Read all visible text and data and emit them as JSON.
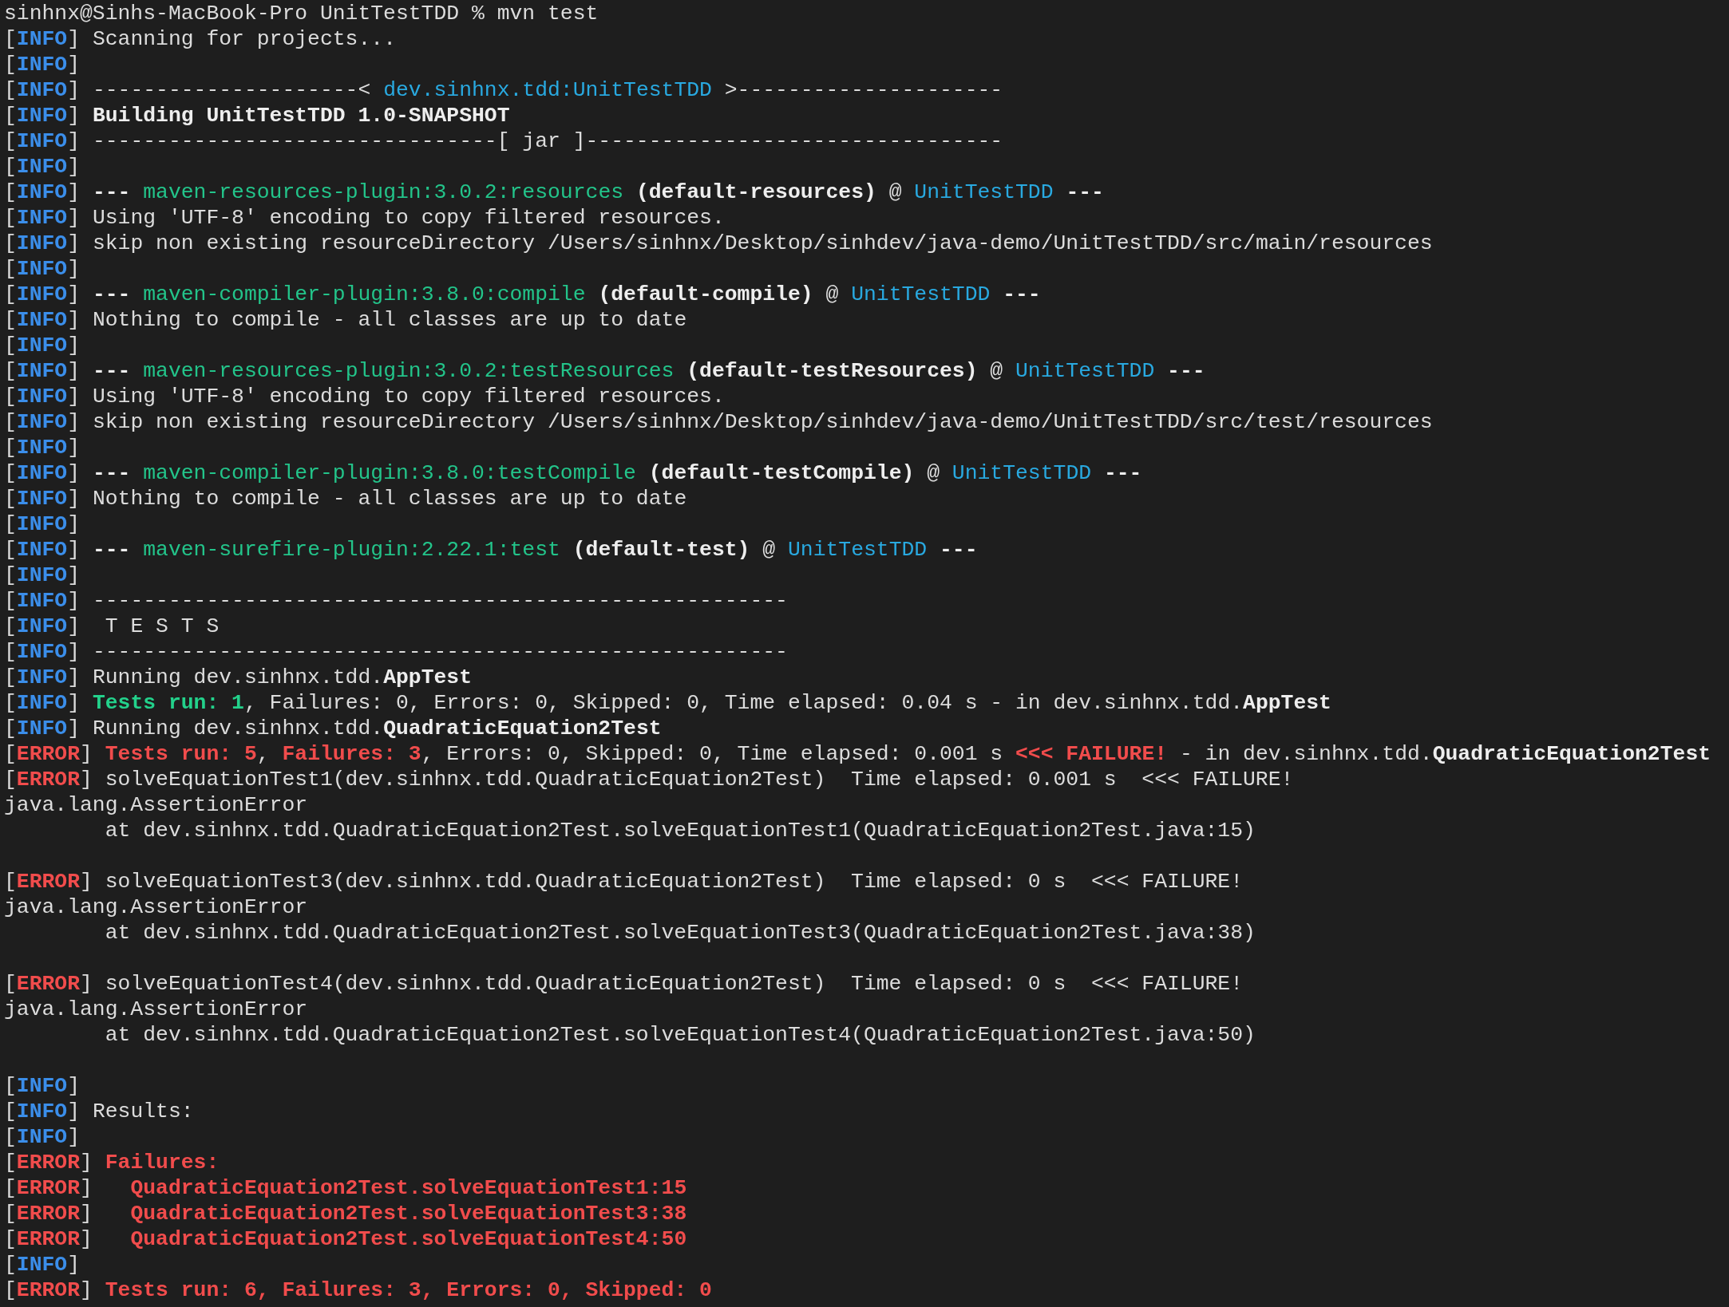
{
  "terminal": {
    "lines": [
      {
        "kind": "text",
        "parts": [
          {
            "kind": "plain",
            "text": "sinhnx@Sinhs-MacBook-Pro UnitTestTDD % mvn test"
          }
        ]
      },
      {
        "kind": "text",
        "parts": [
          {
            "kind": "plain",
            "text": "["
          },
          {
            "kind": "info",
            "text": "INFO"
          },
          {
            "kind": "plain",
            "text": "] Scanning for projects..."
          }
        ]
      },
      {
        "kind": "text",
        "parts": [
          {
            "kind": "plain",
            "text": "["
          },
          {
            "kind": "info",
            "text": "INFO"
          },
          {
            "kind": "plain",
            "text": "]"
          }
        ]
      },
      {
        "kind": "text",
        "parts": [
          {
            "kind": "plain",
            "text": "["
          },
          {
            "kind": "info",
            "text": "INFO"
          },
          {
            "kind": "plain",
            "text": "] ---------------------< "
          },
          {
            "kind": "project",
            "text": "dev.sinhnx.tdd:UnitTestTDD"
          },
          {
            "kind": "plain",
            "text": " >---------------------"
          }
        ]
      },
      {
        "kind": "text",
        "parts": [
          {
            "kind": "plain",
            "text": "["
          },
          {
            "kind": "info",
            "text": "INFO"
          },
          {
            "kind": "plain",
            "text": "] "
          },
          {
            "kind": "bold",
            "text": "Building UnitTestTDD 1.0-SNAPSHOT"
          }
        ]
      },
      {
        "kind": "text",
        "parts": [
          {
            "kind": "plain",
            "text": "["
          },
          {
            "kind": "info",
            "text": "INFO"
          },
          {
            "kind": "plain",
            "text": "] --------------------------------[ jar ]---------------------------------"
          }
        ]
      },
      {
        "kind": "text",
        "parts": [
          {
            "kind": "plain",
            "text": "["
          },
          {
            "kind": "info",
            "text": "INFO"
          },
          {
            "kind": "plain",
            "text": "]"
          }
        ]
      },
      {
        "kind": "text",
        "parts": [
          {
            "kind": "plain",
            "text": "["
          },
          {
            "kind": "info",
            "text": "INFO"
          },
          {
            "kind": "plain",
            "text": "] "
          },
          {
            "kind": "bold",
            "text": "--- "
          },
          {
            "kind": "plugin",
            "text": "maven-resources-plugin:3.0.2:resources"
          },
          {
            "kind": "bold",
            "text": " (default-resources)"
          },
          {
            "kind": "plain",
            "text": " @ "
          },
          {
            "kind": "project",
            "text": "UnitTestTDD"
          },
          {
            "kind": "bold",
            "text": " ---"
          }
        ]
      },
      {
        "kind": "text",
        "parts": [
          {
            "kind": "plain",
            "text": "["
          },
          {
            "kind": "info",
            "text": "INFO"
          },
          {
            "kind": "plain",
            "text": "] Using 'UTF-8' encoding to copy filtered resources."
          }
        ]
      },
      {
        "kind": "text",
        "parts": [
          {
            "kind": "plain",
            "text": "["
          },
          {
            "kind": "info",
            "text": "INFO"
          },
          {
            "kind": "plain",
            "text": "] skip non existing resourceDirectory /Users/sinhnx/Desktop/sinhdev/java-demo/UnitTestTDD/src/main/resources"
          }
        ]
      },
      {
        "kind": "text",
        "parts": [
          {
            "kind": "plain",
            "text": "["
          },
          {
            "kind": "info",
            "text": "INFO"
          },
          {
            "kind": "plain",
            "text": "]"
          }
        ]
      },
      {
        "kind": "text",
        "parts": [
          {
            "kind": "plain",
            "text": "["
          },
          {
            "kind": "info",
            "text": "INFO"
          },
          {
            "kind": "plain",
            "text": "] "
          },
          {
            "kind": "bold",
            "text": "--- "
          },
          {
            "kind": "plugin",
            "text": "maven-compiler-plugin:3.8.0:compile"
          },
          {
            "kind": "bold",
            "text": " (default-compile)"
          },
          {
            "kind": "plain",
            "text": " @ "
          },
          {
            "kind": "project",
            "text": "UnitTestTDD"
          },
          {
            "kind": "bold",
            "text": " ---"
          }
        ]
      },
      {
        "kind": "text",
        "parts": [
          {
            "kind": "plain",
            "text": "["
          },
          {
            "kind": "info",
            "text": "INFO"
          },
          {
            "kind": "plain",
            "text": "] Nothing to compile - all classes are up to date"
          }
        ]
      },
      {
        "kind": "text",
        "parts": [
          {
            "kind": "plain",
            "text": "["
          },
          {
            "kind": "info",
            "text": "INFO"
          },
          {
            "kind": "plain",
            "text": "]"
          }
        ]
      },
      {
        "kind": "text",
        "parts": [
          {
            "kind": "plain",
            "text": "["
          },
          {
            "kind": "info",
            "text": "INFO"
          },
          {
            "kind": "plain",
            "text": "] "
          },
          {
            "kind": "bold",
            "text": "--- "
          },
          {
            "kind": "plugin",
            "text": "maven-resources-plugin:3.0.2:testResources"
          },
          {
            "kind": "bold",
            "text": " (default-testResources)"
          },
          {
            "kind": "plain",
            "text": " @ "
          },
          {
            "kind": "project",
            "text": "UnitTestTDD"
          },
          {
            "kind": "bold",
            "text": " ---"
          }
        ]
      },
      {
        "kind": "text",
        "parts": [
          {
            "kind": "plain",
            "text": "["
          },
          {
            "kind": "info",
            "text": "INFO"
          },
          {
            "kind": "plain",
            "text": "] Using 'UTF-8' encoding to copy filtered resources."
          }
        ]
      },
      {
        "kind": "text",
        "parts": [
          {
            "kind": "plain",
            "text": "["
          },
          {
            "kind": "info",
            "text": "INFO"
          },
          {
            "kind": "plain",
            "text": "] skip non existing resourceDirectory /Users/sinhnx/Desktop/sinhdev/java-demo/UnitTestTDD/src/test/resources"
          }
        ]
      },
      {
        "kind": "text",
        "parts": [
          {
            "kind": "plain",
            "text": "["
          },
          {
            "kind": "info",
            "text": "INFO"
          },
          {
            "kind": "plain",
            "text": "]"
          }
        ]
      },
      {
        "kind": "text",
        "parts": [
          {
            "kind": "plain",
            "text": "["
          },
          {
            "kind": "info",
            "text": "INFO"
          },
          {
            "kind": "plain",
            "text": "] "
          },
          {
            "kind": "bold",
            "text": "--- "
          },
          {
            "kind": "plugin",
            "text": "maven-compiler-plugin:3.8.0:testCompile"
          },
          {
            "kind": "bold",
            "text": " (default-testCompile)"
          },
          {
            "kind": "plain",
            "text": " @ "
          },
          {
            "kind": "project",
            "text": "UnitTestTDD"
          },
          {
            "kind": "bold",
            "text": " ---"
          }
        ]
      },
      {
        "kind": "text",
        "parts": [
          {
            "kind": "plain",
            "text": "["
          },
          {
            "kind": "info",
            "text": "INFO"
          },
          {
            "kind": "plain",
            "text": "] Nothing to compile - all classes are up to date"
          }
        ]
      },
      {
        "kind": "text",
        "parts": [
          {
            "kind": "plain",
            "text": "["
          },
          {
            "kind": "info",
            "text": "INFO"
          },
          {
            "kind": "plain",
            "text": "]"
          }
        ]
      },
      {
        "kind": "text",
        "parts": [
          {
            "kind": "plain",
            "text": "["
          },
          {
            "kind": "info",
            "text": "INFO"
          },
          {
            "kind": "plain",
            "text": "] "
          },
          {
            "kind": "bold",
            "text": "--- "
          },
          {
            "kind": "plugin",
            "text": "maven-surefire-plugin:2.22.1:test"
          },
          {
            "kind": "bold",
            "text": " (default-test)"
          },
          {
            "kind": "plain",
            "text": " @ "
          },
          {
            "kind": "project",
            "text": "UnitTestTDD"
          },
          {
            "kind": "bold",
            "text": " ---"
          }
        ]
      },
      {
        "kind": "text",
        "parts": [
          {
            "kind": "plain",
            "text": "["
          },
          {
            "kind": "info",
            "text": "INFO"
          },
          {
            "kind": "plain",
            "text": "]"
          }
        ]
      },
      {
        "kind": "text",
        "parts": [
          {
            "kind": "plain",
            "text": "["
          },
          {
            "kind": "info",
            "text": "INFO"
          },
          {
            "kind": "plain",
            "text": "] -------------------------------------------------------"
          }
        ]
      },
      {
        "kind": "text",
        "parts": [
          {
            "kind": "plain",
            "text": "["
          },
          {
            "kind": "info",
            "text": "INFO"
          },
          {
            "kind": "plain",
            "text": "]  T E S T S"
          }
        ]
      },
      {
        "kind": "text",
        "parts": [
          {
            "kind": "plain",
            "text": "["
          },
          {
            "kind": "info",
            "text": "INFO"
          },
          {
            "kind": "plain",
            "text": "] -------------------------------------------------------"
          }
        ]
      },
      {
        "kind": "text",
        "parts": [
          {
            "kind": "plain",
            "text": "["
          },
          {
            "kind": "info",
            "text": "INFO"
          },
          {
            "kind": "plain",
            "text": "] Running dev.sinhnx.tdd."
          },
          {
            "kind": "bold",
            "text": "AppTest"
          }
        ]
      },
      {
        "kind": "text",
        "parts": [
          {
            "kind": "plain",
            "text": "["
          },
          {
            "kind": "info",
            "text": "INFO"
          },
          {
            "kind": "plain",
            "text": "] "
          },
          {
            "kind": "success",
            "text": "Tests run: 1"
          },
          {
            "kind": "plain",
            "text": ", Failures: 0, Errors: 0, Skipped: 0, Time elapsed: 0.04 s - in dev.sinhnx.tdd."
          },
          {
            "kind": "bold",
            "text": "AppTest"
          }
        ]
      },
      {
        "kind": "text",
        "parts": [
          {
            "kind": "plain",
            "text": "["
          },
          {
            "kind": "info",
            "text": "INFO"
          },
          {
            "kind": "plain",
            "text": "] Running dev.sinhnx.tdd."
          },
          {
            "kind": "bold",
            "text": "QuadraticEquation2Test"
          }
        ]
      },
      {
        "kind": "text",
        "parts": [
          {
            "kind": "plain",
            "text": "["
          },
          {
            "kind": "error",
            "text": "ERROR"
          },
          {
            "kind": "plain",
            "text": "] "
          },
          {
            "kind": "failure",
            "text": "Tests run: 5"
          },
          {
            "kind": "plain",
            "text": ", "
          },
          {
            "kind": "failure",
            "text": "Failures: 3"
          },
          {
            "kind": "plain",
            "text": ", Errors: 0, Skipped: 0, Time elapsed: 0.001 s "
          },
          {
            "kind": "failure",
            "text": "<<< FAILURE!"
          },
          {
            "kind": "plain",
            "text": " - in dev.sinhnx.tdd."
          },
          {
            "kind": "bold",
            "text": "QuadraticEquation2Test"
          }
        ]
      },
      {
        "kind": "text",
        "parts": [
          {
            "kind": "plain",
            "text": "["
          },
          {
            "kind": "error",
            "text": "ERROR"
          },
          {
            "kind": "plain",
            "text": "] solveEquationTest1(dev.sinhnx.tdd.QuadraticEquation2Test)  Time elapsed: 0.001 s  <<< FAILURE!"
          }
        ]
      },
      {
        "kind": "text",
        "parts": [
          {
            "kind": "plain",
            "text": "java.lang.AssertionError"
          }
        ]
      },
      {
        "kind": "text",
        "parts": [
          {
            "kind": "plain",
            "text": "        at dev.sinhnx.tdd.QuadraticEquation2Test.solveEquationTest1(QuadraticEquation2Test.java:15)"
          }
        ]
      },
      {
        "kind": "blank"
      },
      {
        "kind": "text",
        "parts": [
          {
            "kind": "plain",
            "text": "["
          },
          {
            "kind": "error",
            "text": "ERROR"
          },
          {
            "kind": "plain",
            "text": "] solveEquationTest3(dev.sinhnx.tdd.QuadraticEquation2Test)  Time elapsed: 0 s  <<< FAILURE!"
          }
        ]
      },
      {
        "kind": "text",
        "parts": [
          {
            "kind": "plain",
            "text": "java.lang.AssertionError"
          }
        ]
      },
      {
        "kind": "text",
        "parts": [
          {
            "kind": "plain",
            "text": "        at dev.sinhnx.tdd.QuadraticEquation2Test.solveEquationTest3(QuadraticEquation2Test.java:38)"
          }
        ]
      },
      {
        "kind": "blank"
      },
      {
        "kind": "text",
        "parts": [
          {
            "kind": "plain",
            "text": "["
          },
          {
            "kind": "error",
            "text": "ERROR"
          },
          {
            "kind": "plain",
            "text": "] solveEquationTest4(dev.sinhnx.tdd.QuadraticEquation2Test)  Time elapsed: 0 s  <<< FAILURE!"
          }
        ]
      },
      {
        "kind": "text",
        "parts": [
          {
            "kind": "plain",
            "text": "java.lang.AssertionError"
          }
        ]
      },
      {
        "kind": "text",
        "parts": [
          {
            "kind": "plain",
            "text": "        at dev.sinhnx.tdd.QuadraticEquation2Test.solveEquationTest4(QuadraticEquation2Test.java:50)"
          }
        ]
      },
      {
        "kind": "blank"
      },
      {
        "kind": "text",
        "parts": [
          {
            "kind": "plain",
            "text": "["
          },
          {
            "kind": "info",
            "text": "INFO"
          },
          {
            "kind": "plain",
            "text": "]"
          }
        ]
      },
      {
        "kind": "text",
        "parts": [
          {
            "kind": "plain",
            "text": "["
          },
          {
            "kind": "info",
            "text": "INFO"
          },
          {
            "kind": "plain",
            "text": "] Results:"
          }
        ]
      },
      {
        "kind": "text",
        "parts": [
          {
            "kind": "plain",
            "text": "["
          },
          {
            "kind": "info",
            "text": "INFO"
          },
          {
            "kind": "plain",
            "text": "]"
          }
        ]
      },
      {
        "kind": "text",
        "parts": [
          {
            "kind": "plain",
            "text": "["
          },
          {
            "kind": "error",
            "text": "ERROR"
          },
          {
            "kind": "plain",
            "text": "] "
          },
          {
            "kind": "failure",
            "text": "Failures:"
          }
        ]
      },
      {
        "kind": "text",
        "parts": [
          {
            "kind": "plain",
            "text": "["
          },
          {
            "kind": "error",
            "text": "ERROR"
          },
          {
            "kind": "plain",
            "text": "]   "
          },
          {
            "kind": "failure",
            "text": "QuadraticEquation2Test.solveEquationTest1:15"
          }
        ]
      },
      {
        "kind": "text",
        "parts": [
          {
            "kind": "plain",
            "text": "["
          },
          {
            "kind": "error",
            "text": "ERROR"
          },
          {
            "kind": "plain",
            "text": "]   "
          },
          {
            "kind": "failure",
            "text": "QuadraticEquation2Test.solveEquationTest3:38"
          }
        ]
      },
      {
        "kind": "text",
        "parts": [
          {
            "kind": "plain",
            "text": "["
          },
          {
            "kind": "error",
            "text": "ERROR"
          },
          {
            "kind": "plain",
            "text": "]   "
          },
          {
            "kind": "failure",
            "text": "QuadraticEquation2Test.solveEquationTest4:50"
          }
        ]
      },
      {
        "kind": "text",
        "parts": [
          {
            "kind": "plain",
            "text": "["
          },
          {
            "kind": "info",
            "text": "INFO"
          },
          {
            "kind": "plain",
            "text": "]"
          }
        ]
      },
      {
        "kind": "text",
        "parts": [
          {
            "kind": "plain",
            "text": "["
          },
          {
            "kind": "error",
            "text": "ERROR"
          },
          {
            "kind": "plain",
            "text": "] "
          },
          {
            "kind": "failure",
            "text": "Tests run: 6, Failures: 3, Errors: 0, Skipped: 0"
          }
        ]
      }
    ]
  }
}
